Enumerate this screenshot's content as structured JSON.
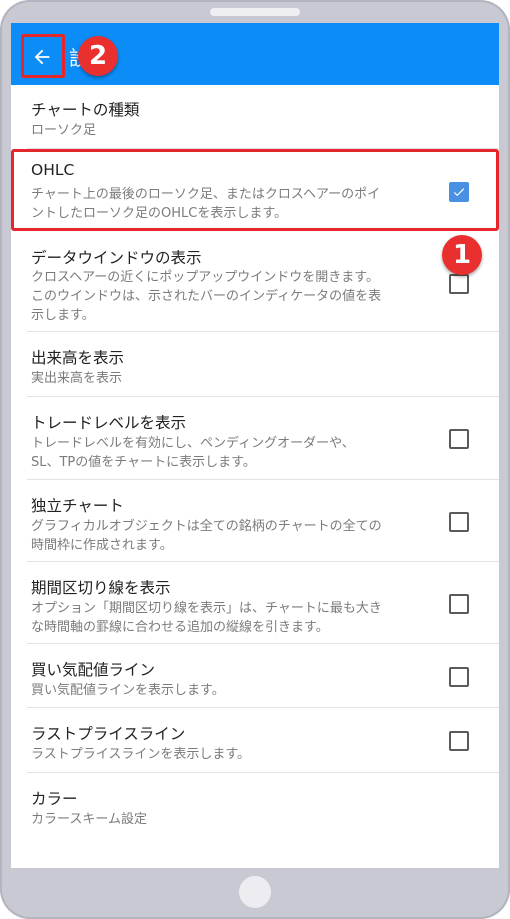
{
  "header": {
    "title": "設定"
  },
  "settings": [
    {
      "title": "チャートの種類",
      "sub1": "ローソク足",
      "sub2": "",
      "sub3": "",
      "has_checkbox": false,
      "checked": false
    },
    {
      "title": "OHLC",
      "sub1": "チャート上の最後のローソク足、またはクロスヘアーのポイ",
      "sub2": "ントしたローソク足のOHLCを表示します。",
      "sub3": "",
      "has_checkbox": true,
      "checked": true
    },
    {
      "title": "データウインドウの表示",
      "sub1": "クロスヘアーの近くにポップアップウインドウを開きます。",
      "sub2": "このウインドウは、示されたバーのインディケータの値を表",
      "sub3": "示します。",
      "has_checkbox": true,
      "checked": false
    },
    {
      "title": "出来高を表示",
      "sub1": "実出来高を表示",
      "sub2": "",
      "sub3": "",
      "has_checkbox": false,
      "checked": false
    },
    {
      "title": "トレードレベルを表示",
      "sub1": "トレードレベルを有効にし、ペンディングオーダーや、",
      "sub2": "SL、TPの値をチャートに表示します。",
      "sub3": "",
      "has_checkbox": true,
      "checked": false
    },
    {
      "title": "独立チャート",
      "sub1": "グラフィカルオブジェクトは全ての銘柄のチャートの全ての",
      "sub2": "時間枠に作成されます。",
      "sub3": "",
      "has_checkbox": true,
      "checked": false
    },
    {
      "title": "期間区切り線を表示",
      "sub1": "オプション「期間区切り線を表示」は、チャートに最も大き",
      "sub2": "な時間軸の罫線に合わせる追加の縦線を引きます。",
      "sub3": "",
      "has_checkbox": true,
      "checked": false
    },
    {
      "title": "買い気配値ライン",
      "sub1": "買い気配値ラインを表示します。",
      "sub2": "",
      "sub3": "",
      "has_checkbox": true,
      "checked": false
    },
    {
      "title": "ラストプライスライン",
      "sub1": "ラストプライスラインを表示します。",
      "sub2": "",
      "sub3": "",
      "has_checkbox": true,
      "checked": false
    },
    {
      "title": "カラー",
      "sub1": "カラースキーム設定",
      "sub2": "",
      "sub3": "",
      "has_checkbox": false,
      "checked": false
    }
  ],
  "annotations": {
    "badge1": "1",
    "badge2": "2"
  },
  "colors": {
    "appbar": "#0c8cf7",
    "highlight": "#e5262b",
    "checkbox_checked": "#4a90e2"
  },
  "icons": {
    "back": "arrow-left-icon",
    "check": "check-icon"
  }
}
